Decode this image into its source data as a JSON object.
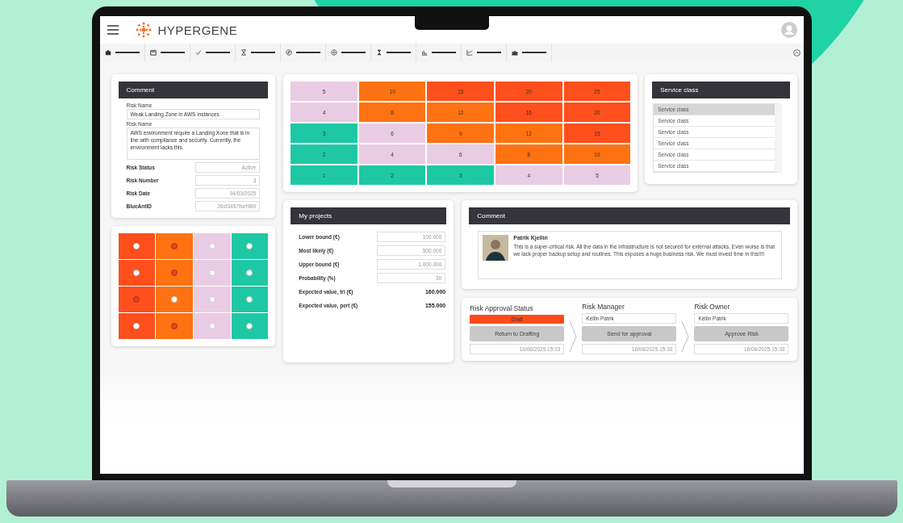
{
  "app": {
    "brand": "HYPERGENE"
  },
  "risk_card": {
    "title": "Comment",
    "name_label": "Risk Name",
    "name_value": "Weak Landing Zone in AWS instances",
    "description_label": "Risk Name",
    "description_value": "AWS environment require a Landing Xone that is in line with compliance and security. Currently, the environment lacks this.",
    "fields": [
      {
        "label": "Risk Status",
        "value": "Active"
      },
      {
        "label": "Risk Number",
        "value": "3"
      },
      {
        "label": "Risk Date",
        "value": "04/03/2025"
      },
      {
        "label": "BlueAntID",
        "value": "26sf3457fsef969"
      }
    ]
  },
  "dot_grid": {
    "rows": [
      {
        "cells": [
          {
            "color": "#ff4f1c",
            "selected": false
          },
          {
            "color": "#ff7212",
            "selected": true
          },
          {
            "color": "#e9cce3",
            "selected": false
          },
          {
            "color": "#1ec8a5",
            "selected": false
          }
        ]
      },
      {
        "cells": [
          {
            "color": "#ff4f1c",
            "selected": false
          },
          {
            "color": "#ff7212",
            "selected": true
          },
          {
            "color": "#e9cce3",
            "selected": false
          },
          {
            "color": "#1ec8a5",
            "selected": false
          }
        ]
      },
      {
        "cells": [
          {
            "color": "#ff4f1c",
            "selected": true
          },
          {
            "color": "#ff7212",
            "selected": false
          },
          {
            "color": "#e9cce3",
            "selected": false
          },
          {
            "color": "#1ec8a5",
            "selected": false
          }
        ]
      },
      {
        "cells": [
          {
            "color": "#ff4f1c",
            "selected": false
          },
          {
            "color": "#ff7212",
            "selected": true
          },
          {
            "color": "#e9cce3",
            "selected": false
          },
          {
            "color": "#1ec8a5",
            "selected": false
          }
        ]
      }
    ]
  },
  "heatmap": {
    "rows": [
      {
        "cells": [
          {
            "value": "5",
            "color": "#e9cce3"
          },
          {
            "value": "10",
            "color": "#ff7212"
          },
          {
            "value": "15",
            "color": "#ff4f1c"
          },
          {
            "value": "20",
            "color": "#ff4f1c"
          },
          {
            "value": "25",
            "color": "#ff4f1c"
          }
        ]
      },
      {
        "cells": [
          {
            "value": "4",
            "color": "#e9cce3"
          },
          {
            "value": "8",
            "color": "#ff7212"
          },
          {
            "value": "12",
            "color": "#ff7212"
          },
          {
            "value": "16",
            "color": "#ff4f1c"
          },
          {
            "value": "20",
            "color": "#ff4f1c"
          }
        ]
      },
      {
        "cells": [
          {
            "value": "3",
            "color": "#1ec8a5"
          },
          {
            "value": "6",
            "color": "#e9cce3"
          },
          {
            "value": "9",
            "color": "#ff7212"
          },
          {
            "value": "12",
            "color": "#ff7212"
          },
          {
            "value": "15",
            "color": "#ff4f1c"
          }
        ]
      },
      {
        "cells": [
          {
            "value": "2",
            "color": "#1ec8a5"
          },
          {
            "value": "4",
            "color": "#e9cce3"
          },
          {
            "value": "6",
            "color": "#e9cce3"
          },
          {
            "value": "8",
            "color": "#ff7212"
          },
          {
            "value": "10",
            "color": "#ff7212"
          }
        ]
      },
      {
        "cells": [
          {
            "value": "1",
            "color": "#1ec8a5"
          },
          {
            "value": "2",
            "color": "#1ec8a5"
          },
          {
            "value": "3",
            "color": "#1ec8a5"
          },
          {
            "value": "4",
            "color": "#e9cce3"
          },
          {
            "value": "5",
            "color": "#e9cce3"
          }
        ]
      }
    ]
  },
  "service_class": {
    "title": "Service class",
    "rows": [
      {
        "label": "Service class",
        "selected": true
      },
      {
        "label": "Service class",
        "selected": false
      },
      {
        "label": "Service class",
        "selected": false
      },
      {
        "label": "Service class",
        "selected": false
      },
      {
        "label": "Service class",
        "selected": false
      },
      {
        "label": "Service class",
        "selected": false
      }
    ]
  },
  "projects": {
    "title": "My projects",
    "fields": [
      {
        "label": "Lower bound (€)",
        "value": "100.000",
        "kind": "input"
      },
      {
        "label": "Most likely (€)",
        "value": "500.000",
        "kind": "input"
      },
      {
        "label": "Upper bound (€)",
        "value": "1.000.000",
        "kind": "input"
      },
      {
        "label": "Probability (%)",
        "value": "30",
        "kind": "input"
      },
      {
        "label": "Expected value, tri (€)",
        "value": "160.000",
        "kind": "total"
      },
      {
        "label": "Expected value, pert (€)",
        "value": "155.000",
        "kind": "total"
      }
    ]
  },
  "comment": {
    "title": "Comment",
    "author": "Patrik Kjellin",
    "text": "This is a super-critical risk. All the data in the infrastructure is not secured for external attacks. Even worse is that we lack proper backup setup and routines. This exposes a huge business risk. We must invest time in this!!!!"
  },
  "approval": {
    "steps": [
      {
        "title": "Risk Approval Status",
        "field": "Draft",
        "kind": "status",
        "button": "Return to Drafting",
        "timestamp": "16/06/2025 15:33"
      },
      {
        "title": "Risk Manager",
        "field": "Kellin Patrik",
        "kind": "person",
        "button": "Send for approval",
        "timestamp": "16/06/2025 15:33"
      },
      {
        "title": "Risk Owner",
        "field": "Kellin Patrik",
        "kind": "person",
        "button": "Approve Risk",
        "timestamp": "16/06/2025 15:33"
      }
    ]
  }
}
